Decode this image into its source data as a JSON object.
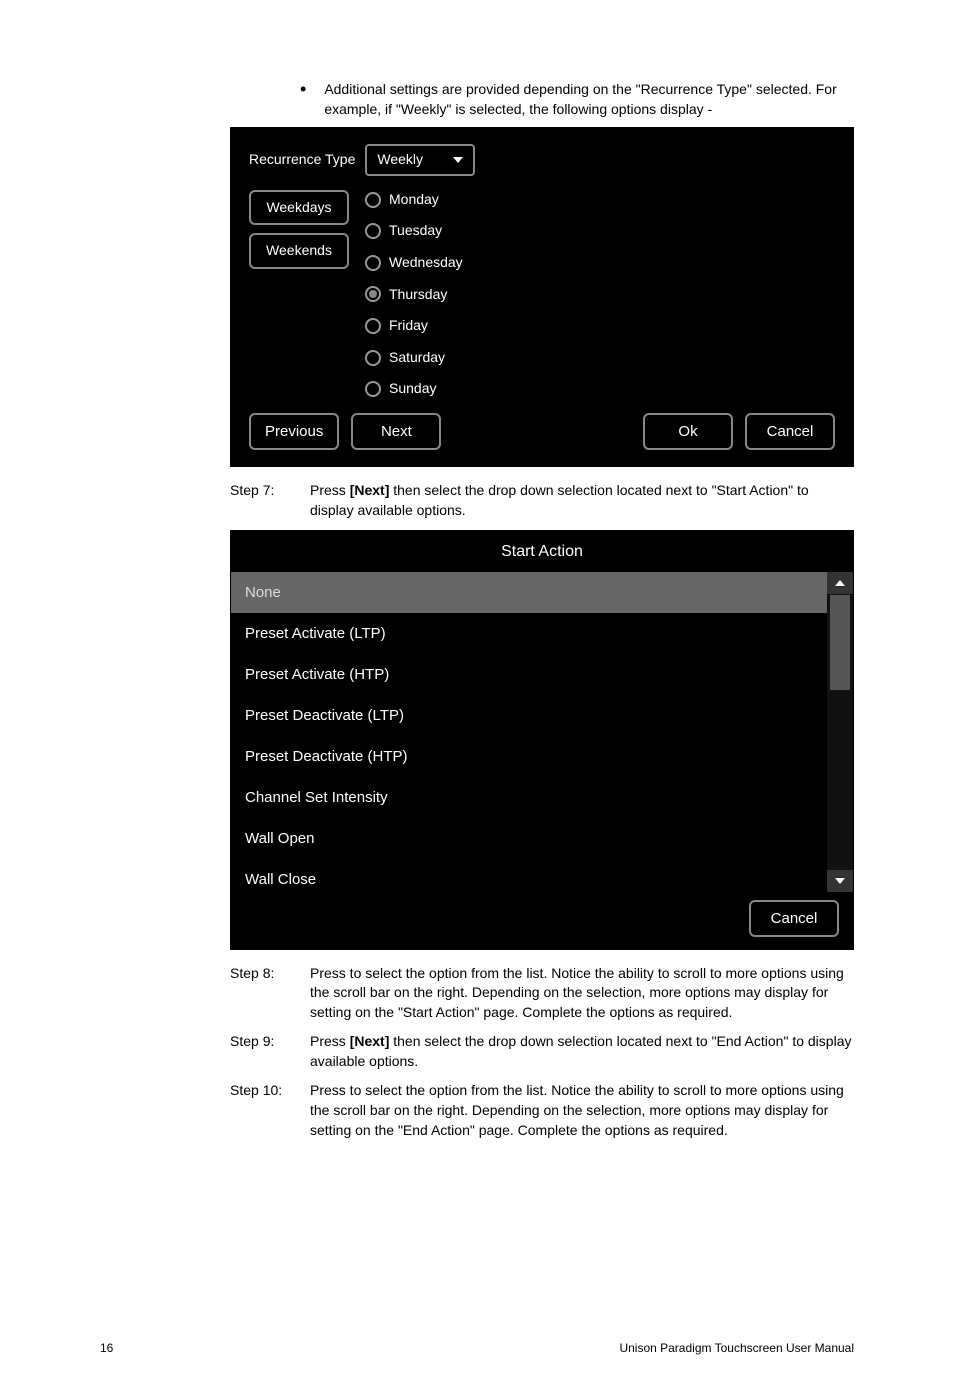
{
  "bullet": "Additional settings are provided depending on the \"Recurrence Type\" selected. For example, if \"Weekly\" is selected, the following options display -",
  "panel1": {
    "recurrence_label": "Recurrence Type",
    "recurrence_value": "Weekly",
    "weekdays_btn": "Weekdays",
    "weekends_btn": "Weekends",
    "days": [
      "Monday",
      "Tuesday",
      "Wednesday",
      "Thursday",
      "Friday",
      "Saturday",
      "Sunday"
    ],
    "previous": "Previous",
    "next": "Next",
    "ok": "Ok",
    "cancel": "Cancel"
  },
  "step7": {
    "label": "Step 7:",
    "text_a": "Press ",
    "bold": "[Next]",
    "text_b": " then select the drop down selection located next to \"Start Action\" to display available options."
  },
  "panel2": {
    "title": "Start Action",
    "items": [
      "None",
      "Preset Activate (LTP)",
      "Preset Activate (HTP)",
      "Preset Deactivate (LTP)",
      "Preset Deactivate (HTP)",
      "Channel Set Intensity",
      "Wall Open",
      "Wall Close"
    ],
    "cancel": "Cancel"
  },
  "step8": {
    "label": "Step 8:",
    "text": "Press to select the option from the list. Notice the ability to scroll to more options using the scroll bar on the right. Depending on the selection, more options may display for setting on the \"Start Action\" page. Complete the options as required."
  },
  "step9": {
    "label": "Step 9:",
    "text_a": "Press ",
    "bold": "[Next]",
    "text_b": " then select the drop down selection located next to \"End Action\" to display available options."
  },
  "step10": {
    "label": "Step 10:",
    "text": "Press to select the option from the list. Notice the ability to scroll to more options using the scroll bar on the right. Depending on the selection, more options may display for setting on the \"End Action\" page. Complete the options as required."
  },
  "footer": {
    "page": "16",
    "title": "Unison Paradigm Touchscreen User Manual"
  }
}
